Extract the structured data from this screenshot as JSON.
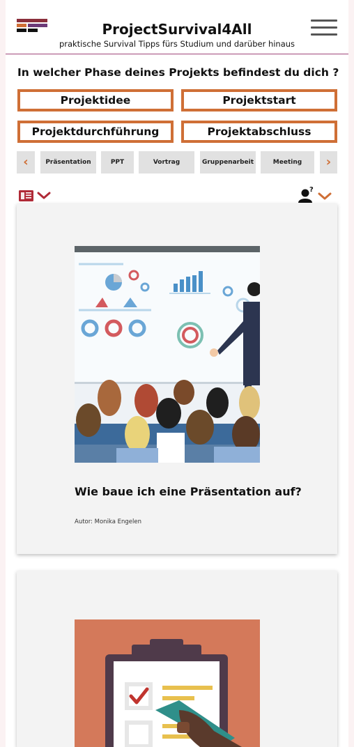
{
  "header": {
    "title": "ProjectSurvival4All",
    "subtitle": "praktische Survival Tipps fürs Studium und darüber hinaus",
    "logo_colors": [
      "#8a2f3c",
      "#cf6f36",
      "#6d3a78",
      "#111111"
    ],
    "menu_icon": "hamburger-icon"
  },
  "phase_question": "In welcher Phase deines Projekts befindest du dich ?",
  "phases": [
    "Projektidee",
    "Projektstart",
    "Projektdurchführung",
    "Projektabschluss"
  ],
  "tags": {
    "prev_icon": "‹",
    "next_icon": "›",
    "items": [
      "Präsentation",
      "PPT",
      "Vortrag",
      "Gruppenarbeit",
      "Meeting"
    ]
  },
  "filters": {
    "left_icon": "document-list-icon",
    "right_icon": "user-question-icon",
    "dropdown_icon": "chevron-down-icon"
  },
  "articles": [
    {
      "title": "Wie baue ich eine Präsentation auf?",
      "author": "Autor: Monika Engelen",
      "image_icon": "presentation-illustration"
    },
    {
      "title": "",
      "author": "",
      "image_icon": "checklist-illustration"
    }
  ],
  "colors": {
    "accent": "#cf6f36",
    "brand_red": "#b02a37",
    "header_rule": "#a0457a",
    "card_bg": "#f3f3f3",
    "tag_bg": "#e1e1e1"
  }
}
